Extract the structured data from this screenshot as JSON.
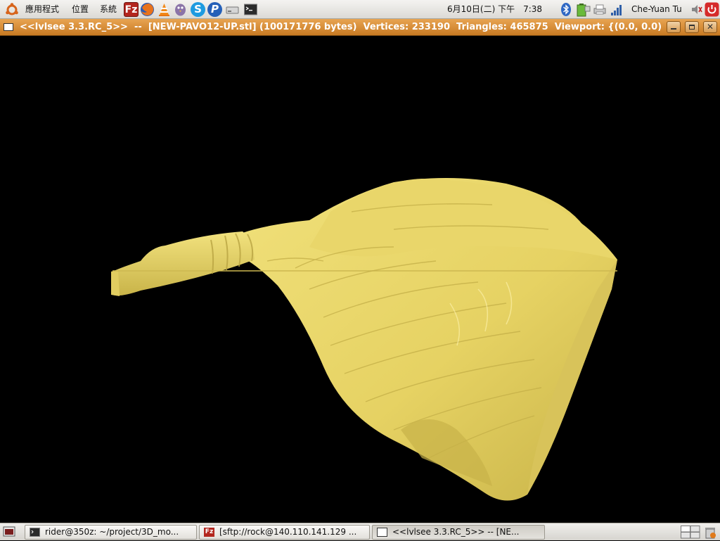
{
  "top_panel": {
    "menus": [
      "應用程式",
      "位置",
      "系統"
    ],
    "launchers": [
      "filezilla-icon",
      "firefox-icon",
      "vlc-icon",
      "pidgin-icon",
      "skype-icon",
      "picasa-icon",
      "drive-icon",
      "terminal-icon"
    ],
    "clock": "6月10日(二) 下午　7:38",
    "user": "Che-Yuan Tu",
    "tray": [
      "bluetooth-icon",
      "battery-icon",
      "printer-icon",
      "wifi-signal-icon",
      "volume-icon",
      "power-icon"
    ]
  },
  "window": {
    "title": "<<lvlsee 3.3.RC_5>>  --  [NEW-PAVO12-UP.stl] (100171776 bytes)  Vertices: 233190  Triangles: 465875  Viewport: {(0.0, 0.0)",
    "buttons": [
      "minimize",
      "maximize",
      "close"
    ]
  },
  "model": {
    "color": "#e9d66a",
    "shade_color": "#b5a03c"
  },
  "taskbar": {
    "tasks": [
      {
        "label": "rider@350z: ~/project/3D_mo...",
        "icon": "terminal-icon"
      },
      {
        "label": "[sftp://rock@140.110.141.129 ...",
        "icon": "filezilla-icon"
      },
      {
        "label": "<<lvlsee 3.3.RC_5>>  --  [NE...",
        "icon": "window-icon"
      }
    ],
    "tray": [
      "workspace-switcher-icon",
      "trash-icon"
    ]
  },
  "colors": {
    "titlebar": "#d98b35",
    "panel": "#e8e6e2",
    "viewport_bg": "#000000"
  }
}
